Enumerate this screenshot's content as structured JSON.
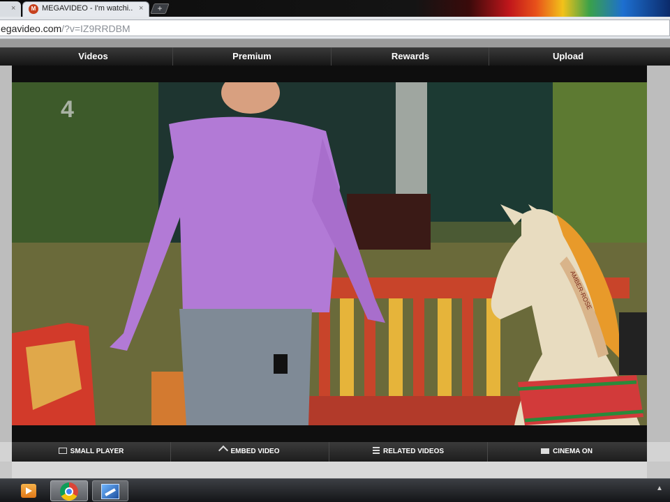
{
  "browser": {
    "previous_tab": {
      "close_glyph": "×"
    },
    "active_tab": {
      "favicon": "M",
      "title": "MEGAVIDEO - I'm watchi...",
      "close_glyph": "×"
    },
    "new_tab_glyph": "+",
    "address_bar": {
      "url_main": "egavideo.com",
      "url_path": "/?v=IZ9RRDBM"
    }
  },
  "site_nav": {
    "items": [
      {
        "label": "Videos"
      },
      {
        "label": "Premium"
      },
      {
        "label": "Rewards"
      },
      {
        "label": "Upload"
      }
    ]
  },
  "video": {
    "channel_logo": "4",
    "horse_text": "AMBER-ROSE"
  },
  "player_controls": {
    "items": [
      {
        "label": "SMALL PLAYER",
        "icon": "small-player-icon"
      },
      {
        "label": "EMBED VIDEO",
        "icon": "embed-link-icon"
      },
      {
        "label": "RELATED VIDEOS",
        "icon": "related-list-icon"
      },
      {
        "label": "CINEMA ON",
        "icon": "cinema-icon"
      }
    ]
  },
  "taskbar": {
    "items": [
      {
        "name": "media-player",
        "icon": "media-player-icon"
      },
      {
        "name": "chrome",
        "icon": "chrome-icon"
      },
      {
        "name": "app",
        "icon": "app-window-icon"
      }
    ],
    "tray_glyph": "▲"
  },
  "colors": {
    "tabstrip_bg": "#0b0b0b",
    "nav_bg": "#1f1f1f",
    "page_bg": "#d3d3d3",
    "taskbar_bg": "#2a2c30"
  }
}
